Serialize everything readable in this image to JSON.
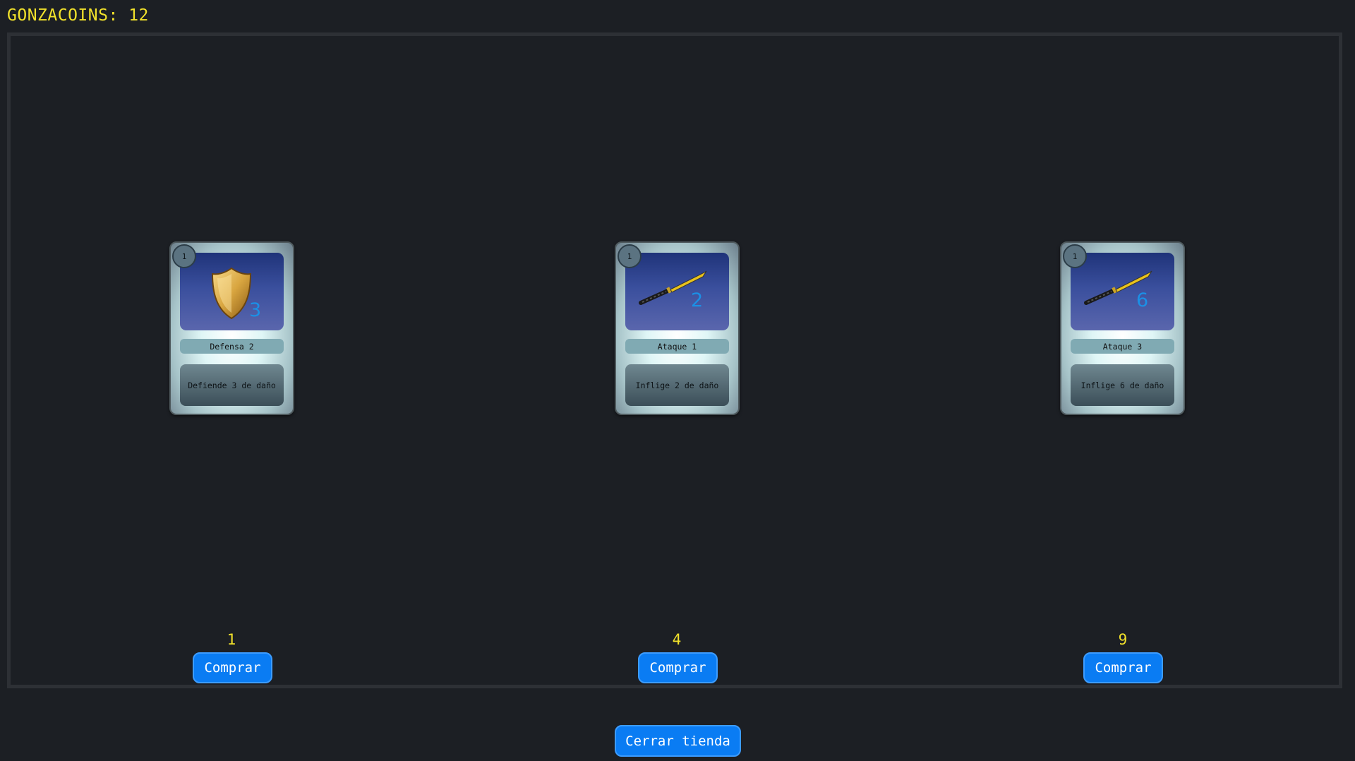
{
  "header": {
    "coins_label": "GONZACOINS:",
    "coins_value": "12",
    "text_color": "#f2e22b"
  },
  "shop": {
    "items": [
      {
        "cost": "1",
        "icon": "shield-icon",
        "value": "3",
        "name": "Defensa 2",
        "description": "Defiende 3 de daño",
        "price": "1",
        "buy_label": "Comprar"
      },
      {
        "cost": "1",
        "icon": "sword-icon",
        "value": "2",
        "name": "Ataque 1",
        "description": "Inflige 2 de daño",
        "price": "4",
        "buy_label": "Comprar"
      },
      {
        "cost": "1",
        "icon": "sword-icon",
        "value": "6",
        "name": "Ataque 3",
        "description": "Inflige 6 de daño",
        "price": "9",
        "buy_label": "Comprar"
      }
    ],
    "close_label": "Cerrar tienda",
    "button_color": "#0a7cf3"
  }
}
